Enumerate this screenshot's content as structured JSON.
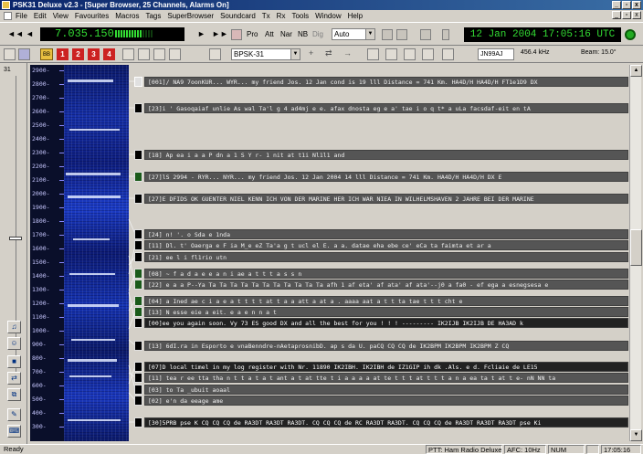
{
  "window": {
    "title": "PSK31 Deluxe v2.3 - [Super Browser, 25 Channels, Alarms On]",
    "buttons": [
      "_",
      "▫",
      "x"
    ]
  },
  "menu": [
    "File",
    "Edit",
    "View",
    "Favourites",
    "Macros",
    "Tags",
    "SuperBrowser",
    "Soundcard",
    "Tx",
    "Rx",
    "Tools",
    "Window",
    "Help"
  ],
  "toolbar": {
    "rewind": "◄◄",
    "back": "◄",
    "frequency": "7.035.150",
    "play": "►",
    "fastforward": "►►",
    "pro": "Pro",
    "att": "Att",
    "nar": "Nar",
    "nb": "NB",
    "dig": "Dig",
    "agc_mode": "Auto",
    "datetime": "12 Jan 2004 17:05:16 UTC"
  },
  "toolbar2": {
    "bb": "BB",
    "channel_buttons": [
      "1",
      "2",
      "3",
      "4"
    ],
    "mode": "BPSK-31",
    "locator": "JN99AJ",
    "offset": "456.4 kHz",
    "beam": "Beam: 15.0°"
  },
  "leftstrip": {
    "number": "31"
  },
  "waterfall": {
    "ticks": [
      "2900-",
      "2800-",
      "2700-",
      "2600-",
      "2500-",
      "2400-",
      "2300-",
      "2200-",
      "2100-",
      "2000-",
      "1900-",
      "1800-",
      "1700-",
      "1600-",
      "1500-",
      "1400-",
      "1300-",
      "1200-",
      "1100-",
      "1000-",
      "900-",
      "800-",
      "700-",
      "600-",
      "500-",
      "400-",
      "300-"
    ]
  },
  "channels": [
    {
      "text": "[001]/ NA9 7oonKUR... WYR... my friend Jos. 12 Jan cond is 19 lll Distance = 741 Km. HA4D/H HA4D/H FT1e1D9 DX"
    },
    {
      "text": "[23]i '  Gasoqaiaf unlie As wal Ta'l g 4 ad4mj e e. afax dnosta eg e a' tae i o q t* a uLa facsdaf-eit en tA"
    },
    {
      "text": "[18]                                                       Ap ea i  a a P dn a 1 S Y r- 1 nit  at t1i Nl1l1  and"
    },
    {
      "text": "[27]lS 2994 - RYR... NYR... my friend Jos. 12 Jan 2004 14 lll Distance = 741 Km. HA4D/H HA4D/H DX E"
    },
    {
      "text": "[27]E DFIDS OK GUENTER NIEL KENN ICH VON DER MARINE HER ICH WAR NIEA IN WILHELMSHAVEN 2 JAHRE BEI DER MARINE"
    },
    {
      "text": "[24]                                                                                  n! '. o Sda e 1nda"
    },
    {
      "text": "[11]                                 Dl. t' Oaerga e F ia M_e eZ Ta'a g t ucl el E. a a. datae eha ebe  ce' eCa ta faimta et ar a"
    },
    {
      "text": "[21]                                                                                    ee l i fl1rio utn"
    },
    {
      "text": "[08]                                                                         ~ f a d a e e a  n i ae a t t t a s s n"
    },
    {
      "text": "[22] e a a P--Ya Ta Ta Ta Ta Ta Ta Ta Ta Ta Ta Ta afh 1 af eta' af ata' af ata'--j0 a fa0 - ef ega a esnegsesa e"
    },
    {
      "text": "[04]                                                   a Ined  ae c i a e a t t t t at t a a att a at a . aaaa aat a t t ta tae t t t cht e"
    },
    {
      "text": "[13]                                                                                         N esse eie a eit. e a e n n a t"
    },
    {
      "text": "[00]ee you again soon.  Vy 73 ES good DX and all the best for you ! ! !  ---------  IK2IJB IK2IJB DE HA3AD k"
    },
    {
      "text": "[13]         6dI.ra in Esporto e vnaBenndre-nAetaprosnibD. ap s da U. paCQ CQ CQ de IK2BPM IK2BPM IK2BPM  Z CQ"
    },
    {
      "text": "[07]D local timel in my log register with Nr. 11890 IK2IBH. IK2IBH de IZ1GIP ih dk .Als. e d.  Fcliaie de LE15"
    },
    {
      "text": "[11] tea r ee tta tha n t t a t a t ant a t at  tte t i a a a a at te t t t at t t t a n a ea ta t at t  e- nN NN ta"
    },
    {
      "text": "[03]                                                                                           to Ta _ubuit aoaal"
    },
    {
      "text": "[02]                                                                                           e'n da eeage ame"
    },
    {
      "text": "[30]5PRB pse K CQ CQ CQ de RA3DT RA3DT RA3DT. CQ CQ CQ de RC RA3DT RA3DT. CQ CQ CQ de RA3DT RA3DT RA3DT pse Ki"
    }
  ],
  "statusbar": {
    "status": "Ready",
    "ptt": "PTT: Ham Radio Deluxe",
    "afc": "AFC: 10Hz",
    "num": "NUM",
    "time": "17:05:16"
  }
}
